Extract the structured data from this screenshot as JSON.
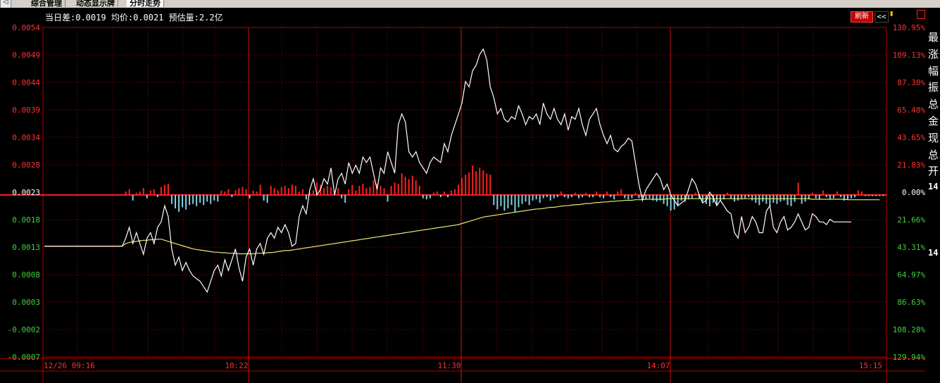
{
  "tabs": [
    {
      "label": "综合管理",
      "active": false
    },
    {
      "label": "动态显示牌",
      "active": false
    },
    {
      "label": "分时走势",
      "active": true
    }
  ],
  "info": {
    "diff_label": "当日差:",
    "diff_value": "0.0019",
    "avg_label": "均价:",
    "avg_value": "0.0021",
    "est_label": "预估量:",
    "est_value": "2.2亿"
  },
  "toolbar": {
    "refresh_label": "刷新",
    "collapse_label": "<<"
  },
  "side_panel": {
    "labels": [
      "最",
      "涨",
      "幅",
      "振",
      "总",
      "金",
      "现",
      "总",
      "开"
    ],
    "numbers": [
      "14",
      "14"
    ]
  },
  "chart_data": {
    "type": "line",
    "price_axis": {
      "ticks": [
        "0.0054",
        "0.0049",
        "0.0044",
        "0.0039",
        "0.0034",
        "0.0028",
        "0.0023",
        "0.0018",
        "0.0013",
        "0.0008",
        "0.0003",
        "-0.0002",
        "-0.0007"
      ],
      "min": -0.0007,
      "max": 0.0054,
      "ref": 0.0023
    },
    "pct_axis": {
      "ticks": [
        "130.95%",
        "109.13%",
        "87.30%",
        "65.48%",
        "43.65%",
        "21.83%",
        "0.00%",
        "21.66%",
        "43.31%",
        "64.97%",
        "86.63%",
        "108.28%",
        "129.94%"
      ]
    },
    "time_ticks": [
      "12/26 09:16",
      "10:22",
      "11:30",
      "14:07",
      "15:15"
    ],
    "colors": {
      "price": "#ffffff",
      "avg": "#e8e870",
      "up": "#ff2020",
      "down": "#7fd0e0",
      "grid": "#b00000",
      "axis_up": "#ff3030",
      "axis_down": "#40d040",
      "axis_ref": "#ffffff"
    },
    "series": [
      {
        "values": [
          0.00135,
          0.00135,
          0.00135,
          0.00135,
          0.00135,
          0.00135,
          0.00135,
          0.00135,
          0.00135,
          0.00135,
          0.00135,
          0.00135,
          0.00135,
          0.00135,
          0.00135,
          0.00135,
          0.00135,
          0.00135,
          0.00135,
          0.00135,
          0.00135,
          0.00135,
          0.00135,
          0.0015,
          0.0017,
          0.0014,
          0.0016,
          0.0014,
          0.0012,
          0.0015,
          0.0016,
          0.0014,
          0.0017,
          0.0018,
          0.0021,
          0.0019,
          0.0013,
          0.001,
          0.00115,
          0.0009,
          0.00105,
          0.0009,
          0.0008,
          0.00075,
          0.0007,
          0.0006,
          0.0005,
          0.0007,
          0.0009,
          0.001,
          0.0008,
          0.0011,
          0.0009,
          0.0011,
          0.0013,
          0.00095,
          0.0007,
          0.00115,
          0.0013,
          0.001,
          0.0013,
          0.0014,
          0.0012,
          0.0015,
          0.0016,
          0.0015,
          0.0017,
          0.0016,
          0.00175,
          0.0016,
          0.00135,
          0.0014,
          0.0019,
          0.0021,
          0.00195,
          0.0024,
          0.0026,
          0.0023,
          0.0024,
          0.0026,
          0.0025,
          0.0028,
          0.0023,
          0.0026,
          0.0027,
          0.0025,
          0.0029,
          0.0027,
          0.00285,
          0.0027,
          0.003,
          0.0029,
          0.003,
          0.0027,
          0.0024,
          0.0028,
          0.0027,
          0.0031,
          0.0029,
          0.0027,
          0.0036,
          0.0038,
          0.00365,
          0.0031,
          0.003,
          0.0031,
          0.0029,
          0.0028,
          0.0027,
          0.0029,
          0.003,
          0.00295,
          0.0029,
          0.00325,
          0.0031,
          0.0034,
          0.0036,
          0.0038,
          0.004,
          0.0044,
          0.0043,
          0.0046,
          0.0047,
          0.0049,
          0.005,
          0.0048,
          0.0043,
          0.0041,
          0.0038,
          0.0039,
          0.0037,
          0.00365,
          0.00375,
          0.0037,
          0.00395,
          0.0038,
          0.0036,
          0.00375,
          0.0037,
          0.0038,
          0.0036,
          0.004,
          0.0038,
          0.0037,
          0.0039,
          0.0037,
          0.0036,
          0.0038,
          0.0035,
          0.00375,
          0.0037,
          0.0039,
          0.0036,
          0.0034,
          0.0037,
          0.0038,
          0.0039,
          0.0036,
          0.0034,
          0.00325,
          0.0034,
          0.00315,
          0.0031,
          0.0032,
          0.00325,
          0.00335,
          0.0033,
          0.0029,
          0.0025,
          0.0022,
          0.0024,
          0.0025,
          0.0026,
          0.0027,
          0.0026,
          0.0024,
          0.0025,
          0.0023,
          0.0022,
          0.0021,
          0.00215,
          0.0022,
          0.0024,
          0.0026,
          0.0025,
          0.0023,
          0.00215,
          0.0022,
          0.00235,
          0.00225,
          0.0021,
          0.0022,
          0.0021,
          0.002,
          0.00195,
          0.0016,
          0.0015,
          0.0019,
          0.0016,
          0.0017,
          0.0019,
          0.0018,
          0.0016,
          0.0016,
          0.002,
          0.0021,
          0.0017,
          0.0016,
          0.0018,
          0.0019,
          0.00165,
          0.0017,
          0.0018,
          0.00195,
          0.0018,
          0.00165,
          0.0017,
          0.00195,
          0.0019,
          0.0018,
          0.0018,
          0.00175,
          0.00185,
          0.0018,
          0.0018,
          0.0018,
          0.0018,
          0.0018,
          0.0018
        ]
      },
      {
        "values": [
          0.00135,
          0.00135,
          0.00135,
          0.00135,
          0.00135,
          0.00135,
          0.00135,
          0.00135,
          0.00135,
          0.00135,
          0.00135,
          0.00135,
          0.00135,
          0.00135,
          0.00135,
          0.00135,
          0.00135,
          0.00135,
          0.00135,
          0.00135,
          0.00135,
          0.00135,
          0.00135,
          0.0014,
          0.00142,
          0.00143,
          0.00144,
          0.00145,
          0.00146,
          0.00146,
          0.00147,
          0.00147,
          0.00148,
          0.00148,
          0.00146,
          0.00144,
          0.00142,
          0.0014,
          0.00138,
          0.00136,
          0.00134,
          0.00132,
          0.0013,
          0.00129,
          0.00128,
          0.00127,
          0.00126,
          0.00125,
          0.00124,
          0.00124,
          0.00123,
          0.00123,
          0.00122,
          0.00122,
          0.00122,
          0.00121,
          0.00121,
          0.00121,
          0.00121,
          0.00121,
          0.00122,
          0.00122,
          0.00122,
          0.00123,
          0.00123,
          0.00124,
          0.00125,
          0.00126,
          0.00127,
          0.00127,
          0.00128,
          0.00129,
          0.0013,
          0.00131,
          0.00132,
          0.00133,
          0.00134,
          0.00135,
          0.00136,
          0.00137,
          0.00138,
          0.00139,
          0.0014,
          0.00141,
          0.00142,
          0.00143,
          0.00144,
          0.00145,
          0.00146,
          0.00147,
          0.00148,
          0.00149,
          0.0015,
          0.00151,
          0.00152,
          0.00153,
          0.00154,
          0.00155,
          0.00156,
          0.00157,
          0.00158,
          0.00159,
          0.0016,
          0.00161,
          0.00162,
          0.00163,
          0.00164,
          0.00165,
          0.00166,
          0.00167,
          0.00168,
          0.00169,
          0.0017,
          0.00171,
          0.00172,
          0.00173,
          0.00174,
          0.00175,
          0.00177,
          0.00179,
          0.00181,
          0.00183,
          0.00185,
          0.00187,
          0.00189,
          0.0019,
          0.00191,
          0.00192,
          0.00193,
          0.00194,
          0.00195,
          0.00196,
          0.00197,
          0.00198,
          0.00199,
          0.002,
          0.00201,
          0.00202,
          0.00203,
          0.00204,
          0.00204,
          0.00205,
          0.00206,
          0.00207,
          0.00207,
          0.00208,
          0.00209,
          0.0021,
          0.0021,
          0.00211,
          0.00212,
          0.00212,
          0.00213,
          0.00214,
          0.00214,
          0.00215,
          0.00216,
          0.00216,
          0.00217,
          0.00217,
          0.00218,
          0.00218,
          0.00219,
          0.00219,
          0.0022,
          0.0022,
          0.0022,
          0.00221,
          0.00221,
          0.00221,
          0.00222,
          0.00222,
          0.00222,
          0.00222,
          0.00222,
          0.00222,
          0.00223,
          0.00223,
          0.00223,
          0.00223,
          0.00223,
          0.00223,
          0.00223,
          0.00223,
          0.00223,
          0.00223,
          0.00223,
          0.00223,
          0.00223,
          0.00223,
          0.00223,
          0.00223,
          0.00223,
          0.00223,
          0.00223,
          0.00223,
          0.00223,
          0.00223,
          0.00223,
          0.00223,
          0.00223,
          0.00223,
          0.00223,
          0.00223,
          0.00223,
          0.00223,
          0.00223,
          0.00223,
          0.00223,
          0.00223,
          0.00223,
          0.00223,
          0.00223,
          0.00223,
          0.00223,
          0.00223,
          0.00223,
          0.00222,
          0.00222,
          0.00222,
          0.00222,
          0.00222,
          0.00222,
          0.00222,
          0.00222,
          0.00222,
          0.00222,
          0.00221,
          0.00221,
          0.00221,
          0.00221,
          0.00221,
          0.00221,
          0.00221,
          0.00221,
          0.00221,
          0.00221
        ]
      }
    ],
    "volume": [
      0,
      0,
      0,
      0,
      0,
      0,
      0,
      0,
      0,
      0,
      0,
      0,
      0,
      0,
      0,
      0,
      0,
      0,
      0,
      0,
      0,
      0,
      0,
      0.3,
      0.5,
      -0.5,
      0.2,
      0.3,
      0.6,
      -0.3,
      0.4,
      0.5,
      -0.2,
      0.7,
      0.9,
      1.0,
      -0.8,
      -1.2,
      -1.5,
      -1.1,
      -1.3,
      -0.9,
      -0.8,
      -1.0,
      -0.7,
      -0.9,
      -0.6,
      -0.8,
      -0.5,
      -0.6,
      0.4,
      0.3,
      0.5,
      -0.2,
      0.4,
      0.6,
      0.7,
      0.5,
      -0.3,
      0.4,
      0.3,
      0.9,
      -0.5,
      -0.7,
      0.8,
      0.6,
      0.4,
      0.7,
      0.8,
      0.6,
      0.9,
      0.8,
      0.3,
      0.5,
      -0.4,
      0.2,
      0.4,
      1.1,
      0.9,
      0.6,
      0.8,
      0.7,
      0.4,
      0.6,
      -0.3,
      -0.7,
      0.5,
      0.9,
      0.4,
      0.8,
      1.0,
      0.6,
      0.7,
      1.3,
      1.0,
      0.8,
      0.6,
      -0.6,
      0.8,
      1.1,
      1.0,
      1.9,
      1.6,
      1.4,
      1.7,
      1.3,
      0.8,
      -0.3,
      -0.4,
      -0.3,
      0.2,
      0.3,
      -0.2,
      0.3,
      -0.2,
      0.4,
      0.5,
      0.9,
      1.5,
      1.8,
      2.0,
      2.6,
      2.1,
      2.4,
      2.2,
      1.9,
      1.8,
      -0.9,
      -1.3,
      -1.0,
      -1.4,
      -1.2,
      -0.9,
      -1.5,
      -1.1,
      -0.8,
      -0.6,
      -0.9,
      -0.5,
      -0.4,
      -0.7,
      -0.3,
      -0.2,
      -0.5,
      -0.3,
      -0.2,
      0.3,
      -0.2,
      -0.3,
      -0.2,
      0.2,
      -0.3,
      -0.2,
      0.2,
      -0.2,
      -0.2,
      0.3,
      -0.2,
      -0.3,
      0.3,
      -0.2,
      -0.4,
      0.3,
      0.5,
      -0.3,
      -0.4,
      -0.3,
      0.2,
      -0.3,
      -0.2,
      -0.4,
      -0.3,
      -0.5,
      -0.6,
      -0.5,
      -0.8,
      -1.0,
      -1.4,
      -1.3,
      -0.9,
      -0.5,
      -0.6,
      -0.4,
      -0.3,
      0.2,
      -0.3,
      -0.6,
      -0.8,
      -1.0,
      -0.7,
      -0.9,
      -0.5,
      -0.4,
      0.2,
      -0.3,
      -0.6,
      -0.5,
      -0.4,
      -0.3,
      -0.2,
      -0.5,
      -0.7,
      -0.9,
      -0.6,
      -0.8,
      -1.0,
      -0.7,
      -0.8,
      -0.6,
      -0.5,
      -0.9,
      -1.0,
      -0.6,
      1.1,
      -0.8,
      -0.6,
      -0.4,
      0.2,
      -0.3,
      -0.4,
      0.4,
      -0.2,
      -0.4,
      -0.3,
      0.3,
      -0.2,
      -0.5,
      -0.4,
      -0.3,
      -0.2,
      0.4,
      0.3,
      -0.1,
      -0.1,
      -0.1,
      -0.1,
      -0.1,
      -0.1
    ]
  }
}
